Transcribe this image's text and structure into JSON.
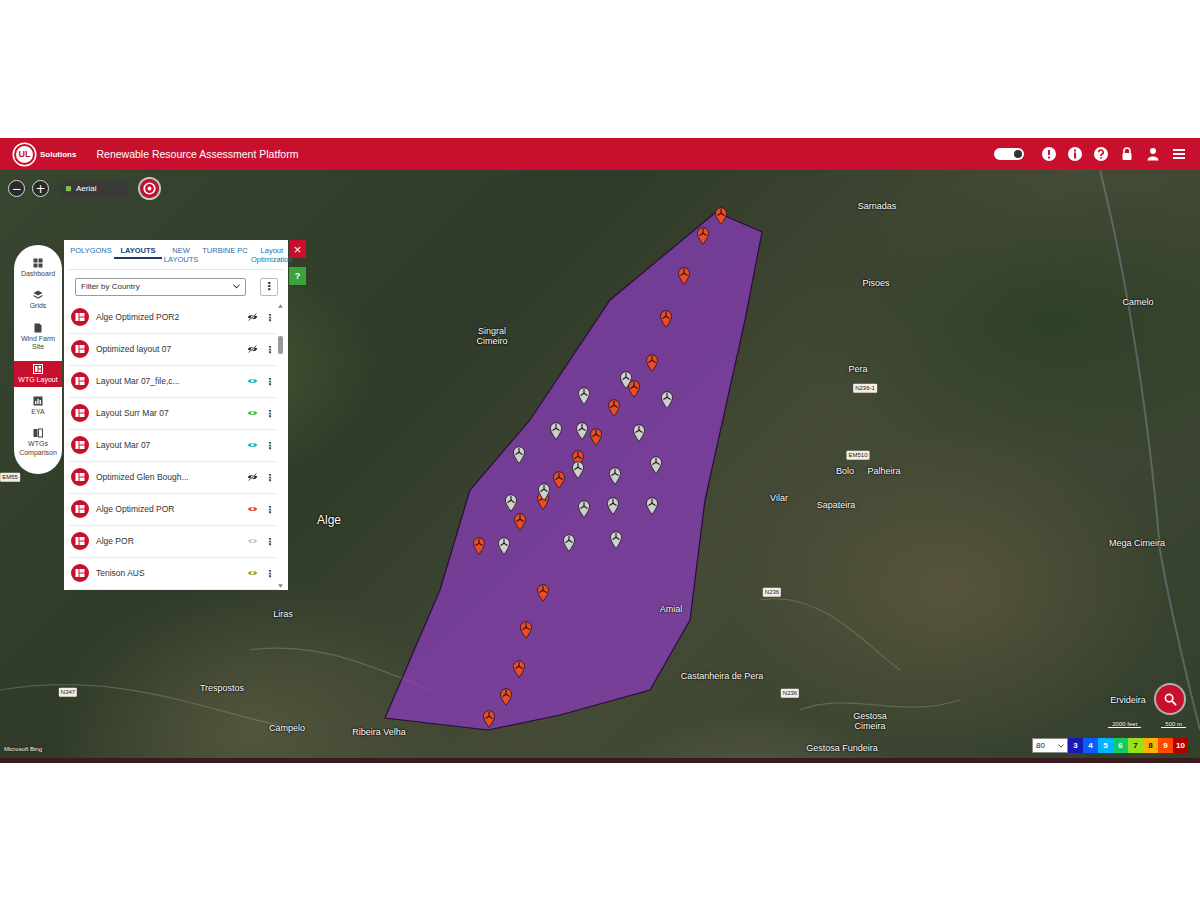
{
  "header": {
    "logo": "UL",
    "brand": "Solutions",
    "title": "Renewable Resource Assessment Platform"
  },
  "map_controls": {
    "zoom_out": "−",
    "zoom_in": "+",
    "basemap": "Aerial"
  },
  "nav": [
    {
      "label": "Dashboard",
      "selected": false
    },
    {
      "label": "Grids",
      "selected": false
    },
    {
      "label": "Wind Farm Site",
      "selected": false
    },
    {
      "label": "WTG Layout",
      "selected": true
    },
    {
      "label": "EYA",
      "selected": false
    },
    {
      "label": "WTGs Comparison",
      "selected": false
    }
  ],
  "panel": {
    "tabs": [
      {
        "label": "POLYGONS",
        "selected": false
      },
      {
        "label": "LAYOUTS",
        "selected": true
      },
      {
        "label": "NEW LAYOUTS",
        "selected": false
      },
      {
        "label": "TURBINE PC",
        "selected": false
      },
      {
        "label": "Layout Optimization",
        "selected": false
      }
    ],
    "close": "×",
    "help": "?",
    "filter": {
      "placeholder": "Filter by Country"
    },
    "menu": "⋮",
    "layouts": [
      {
        "name": "Alge Optimized POR2",
        "color": "#222222",
        "visible": false
      },
      {
        "name": "Optimized layout 07",
        "color": "#222222",
        "visible": false
      },
      {
        "name": "Layout Mar 07_file,c...",
        "color": "#1bb3c8",
        "visible": true
      },
      {
        "name": "Layout Surr Mar 07",
        "color": "#3cc43c",
        "visible": true
      },
      {
        "name": "Layout Mar 07",
        "color": "#1bb3c8",
        "visible": true
      },
      {
        "name": "Optimized Glen Bough...",
        "color": "#222222",
        "visible": false
      },
      {
        "name": "Alge Optimized POR",
        "color": "#e8452b",
        "visible": true
      },
      {
        "name": "Alge POR",
        "color": "#c8c8c8",
        "visible": true
      },
      {
        "name": "Tenison AUS",
        "color": "#a8a020",
        "visible": true
      }
    ]
  },
  "map": {
    "labels": [
      {
        "text": "Sarnadas",
        "kind": "place"
      },
      {
        "text": "Pisoes",
        "kind": "place"
      },
      {
        "text": "Camelo",
        "kind": "place"
      },
      {
        "text": "Singral Cimeiro",
        "kind": "place"
      },
      {
        "text": "Pera",
        "kind": "place"
      },
      {
        "text": "N236-1",
        "kind": "road"
      },
      {
        "text": "EM510",
        "kind": "road"
      },
      {
        "text": "Bolo",
        "kind": "place"
      },
      {
        "text": "Palheira",
        "kind": "place"
      },
      {
        "text": "Vilar",
        "kind": "place"
      },
      {
        "text": "Sapateira",
        "kind": "place"
      },
      {
        "text": "Alge",
        "kind": "town"
      },
      {
        "text": "Mega Cimeira",
        "kind": "place"
      },
      {
        "text": "N236",
        "kind": "road"
      },
      {
        "text": "Amial",
        "kind": "place"
      },
      {
        "text": "Liras",
        "kind": "place"
      },
      {
        "text": "Trespostos",
        "kind": "place"
      },
      {
        "text": "N347",
        "kind": "road"
      },
      {
        "text": "Castanheira de Pera",
        "kind": "place"
      },
      {
        "text": "N236",
        "kind": "road"
      },
      {
        "text": "Ervideira",
        "kind": "place"
      },
      {
        "text": "Gestosa Cimeira",
        "kind": "place"
      },
      {
        "text": "Campelo",
        "kind": "place"
      },
      {
        "text": "Ribeira Velha",
        "kind": "place"
      },
      {
        "text": "Gestosa Fundeira",
        "kind": "place"
      },
      {
        "text": "EM55",
        "kind": "road"
      }
    ],
    "pin_sets": [
      {
        "color": "#ef4a23"
      },
      {
        "color": "#cfcfcf"
      }
    ],
    "attribution": "Microsoft Bing",
    "scale": [
      "2000 feet",
      "500 m"
    ]
  },
  "legend": {
    "height": "80",
    "steps": [
      {
        "label": "3",
        "color": "#1b1bb3"
      },
      {
        "label": "4",
        "color": "#0a5cff"
      },
      {
        "label": "5",
        "color": "#00b4ff"
      },
      {
        "label": "6",
        "color": "#17c964"
      },
      {
        "label": "7",
        "color": "#9ae01a"
      },
      {
        "label": "8",
        "color": "#ffb300"
      },
      {
        "label": "9",
        "color": "#ff4a00"
      },
      {
        "label": "10",
        "color": "#b00000"
      }
    ]
  }
}
